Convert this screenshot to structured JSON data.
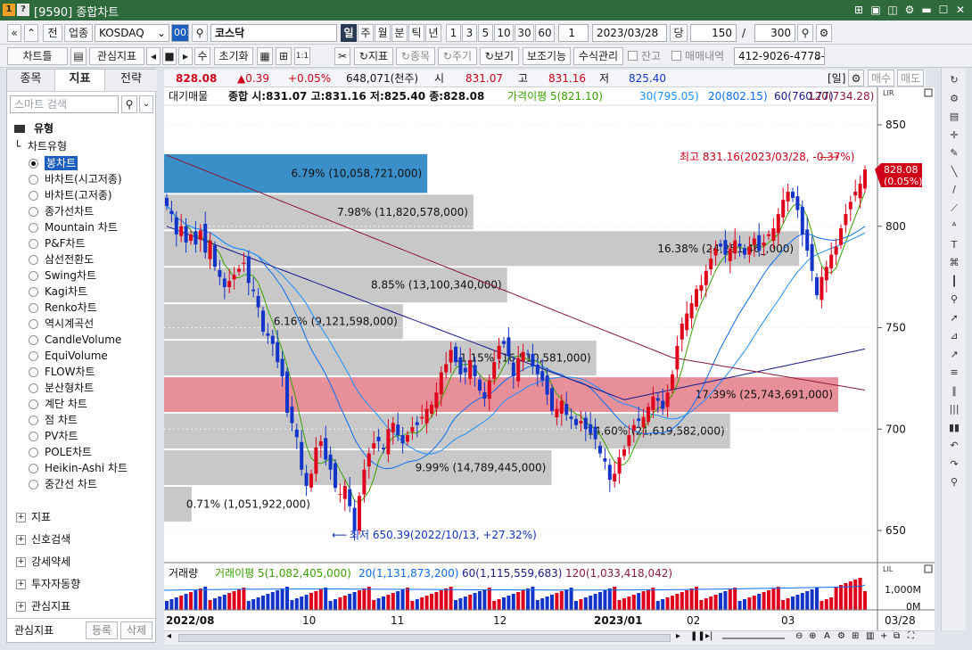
{
  "window": {
    "id": "9590",
    "title": "[9590] 종합차트"
  },
  "toolbar1": {
    "nav_first": "«",
    "nav_up": "»",
    "prev": "전",
    "sector": "업종",
    "market": "KOSDAQ",
    "code": "001",
    "name": "코스닥",
    "periods": [
      "일",
      "주",
      "월",
      "분",
      "틱",
      "년"
    ],
    "period_selected": "일",
    "intervals": [
      "1",
      "3",
      "5",
      "10",
      "30",
      "60"
    ],
    "interval_value": "1",
    "date": "2023/03/28",
    "unit": "당",
    "count": "150",
    "total": "300"
  },
  "toolbar2": {
    "chart_type": "차트틀",
    "watch": "관심지표",
    "init": "초기화",
    "label_1to1": "1:1",
    "indicator": "지표",
    "item": "종목",
    "period": "주기",
    "view": "보기",
    "aux": "보조기능",
    "formula": "수식관리",
    "balance": "잔고",
    "trades": "매매내역",
    "account": "412-9026-4778-2"
  },
  "left_panel": {
    "tabs": [
      "종목",
      "지표",
      "전략"
    ],
    "tab_selected": "지표",
    "search_placeholder": "스마트 검색",
    "section": "유형",
    "group": "차트유형",
    "chart_types": [
      "봉차트",
      "바차트(시고저종)",
      "바차트(고저종)",
      "종가선차트",
      "Mountain 차트",
      "P&F차트",
      "삼선전환도",
      "Swing차트",
      "Kagi차트",
      "Renko차트",
      "역시계곡선",
      "CandleVolume",
      "EquiVolume",
      "FLOW차트",
      "분산형차트",
      "계단 차트",
      "점 차트",
      "PV차트",
      "POLE차트",
      "Heikin-Ashi 차트",
      "중간선 차트"
    ],
    "selected": "봉차트",
    "groups": [
      "지표",
      "신호검색",
      "강세약세",
      "투자자동향",
      "관심지표"
    ],
    "footer": {
      "label": "관심지표",
      "register": "등록",
      "delete": "삭제"
    }
  },
  "quote": {
    "price": "828.08",
    "change": "▲0.39",
    "change_pct": "+0.05%",
    "volume": "648,071(천주)",
    "open_label": "시",
    "open": "831.07",
    "high_label": "고",
    "high": "831.16",
    "low_label": "저",
    "low": "825.40",
    "period_tag": "[일]",
    "buy": "매수",
    "sell": "매도"
  },
  "chart_legend": {
    "title": "대기매물",
    "ohlc": "종합 시:831.07 고:831.16 저:825.40 종:828.08",
    "ma5": "가격이평 5(821.10)",
    "ma20": "20(802.15)",
    "ma30": "30(795.05)",
    "ma60": "60(760.77)",
    "ma120": "120(734.28)"
  },
  "annotations": {
    "high": "최고 831.16(2023/03/28, -0.37%)",
    "low": "최저 650.39(2022/10/13, +27.32%)",
    "last_price": "828.08",
    "last_pct": "(0.05%)"
  },
  "volume_legend": {
    "title": "거래량",
    "ma5": "거래이평 5(1,082,405,000)",
    "ma20": "20(1,131,873,200)",
    "ma60": "60(1,115,559,683)",
    "ma120": "120(1,033,418,042)"
  },
  "volume_axis": [
    "1,000M",
    "0M"
  ],
  "x_labels": [
    "2022/08",
    "10",
    "11",
    "12",
    "2023/01",
    "02",
    "03",
    "03/28"
  ],
  "colors": {
    "up": "#e0001b",
    "down": "#1234c8",
    "ma5": "#3aa000",
    "ma20": "#0b6ef0",
    "ma30": "#1e90ff",
    "ma60": "#1a1a8c",
    "ma120": "#8b1a3a",
    "profile": "#c8c8c8",
    "profile_max": "#e8909a",
    "profile_top": "#3a8fc8"
  },
  "chart_data": {
    "type": "candlestick",
    "title": "",
    "y_ticks": [
      850,
      800,
      750,
      700,
      650
    ],
    "ylim": [
      640,
      870
    ],
    "volume_profile": [
      {
        "low": 816,
        "high": 836,
        "pct": "6.79%",
        "volume": "10,058,721,000"
      },
      {
        "low": 798,
        "high": 816,
        "pct": "7.98%",
        "volume": "11,820,578,000"
      },
      {
        "low": 780,
        "high": 798,
        "pct": "16.38%",
        "volume": "24,251,46_,000"
      },
      {
        "low": 762,
        "high": 780,
        "pct": "8.85%",
        "volume": "13,100,340,000"
      },
      {
        "low": 744,
        "high": 762,
        "pct": "6.16%",
        "volume": "9,121,598,000"
      },
      {
        "low": 726,
        "high": 744,
        "pct": "11.15%",
        "volume": "16,510,581,000"
      },
      {
        "low": 708,
        "high": 726,
        "pct": "17.39%",
        "volume": "25,743,691,000"
      },
      {
        "low": 690,
        "high": 708,
        "pct": "14.60%",
        "volume": "21,619,582,000"
      },
      {
        "low": 672,
        "high": 690,
        "pct": "9.99%",
        "volume": "14,789,445,000"
      },
      {
        "low": 654,
        "high": 672,
        "pct": "0.71%",
        "volume": "1,051,922,000"
      }
    ],
    "high_point": {
      "date": "2023/03/28",
      "value": 831.16
    },
    "low_point": {
      "date": "2022/10/13",
      "value": 650.39
    },
    "last": 828.08
  }
}
